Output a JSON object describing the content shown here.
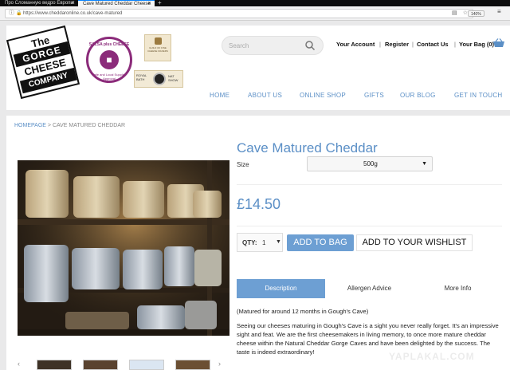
{
  "browser": {
    "tabs": [
      {
        "label": "Про Сломанную ведро Европы"
      },
      {
        "label": "Cave Matured Cheddar Cheese"
      }
    ],
    "url": "https://www.cheddaronline.co.uk/cave-matured",
    "zoom": "140%"
  },
  "header": {
    "logo": {
      "line1": "The Cheddar",
      "line2": "GORGE",
      "line3": "CHEESE",
      "line4": "COMPANY"
    },
    "salsa": {
      "top": "SALSA plus CHEESE",
      "bottom": "Safe and Local Supplier Approval"
    },
    "guild": "GUILD OF FINE CHEESE MAKERS",
    "show": {
      "left": "ROYAL BATH",
      "right": "NAT SHOW"
    },
    "search_placeholder": "Search",
    "links": {
      "account": "Your Account",
      "register": "Register",
      "contact": "Contact Us",
      "bag": "Your Bag (0)"
    },
    "nav": [
      "HOME",
      "ABOUT US",
      "ONLINE SHOP",
      "GIFTS",
      "OUR BLOG",
      "GET IN TOUCH"
    ]
  },
  "breadcrumb": {
    "home": "HOMEPAGE",
    "separator": ">",
    "current": "CAVE MATURED CHEDDAR"
  },
  "product": {
    "title": "Cave Matured Cheddar",
    "size_label": "Size",
    "size_value": "500g",
    "price": "£14.50",
    "qty_label": "QTY:",
    "qty_value": "1",
    "add_to_bag": "ADD TO BAG",
    "wishlist": "ADD TO YOUR WISHLIST",
    "tabs": [
      "Description",
      "Allergen Advice",
      "More Info"
    ],
    "active_tab": "Description",
    "description": [
      "(Matured for around 12 months in Gough's Cave)",
      "Seeing our cheeses maturing in Gough's Cave is a sight you never really forget. It's an impressive sight and feat. We are the first cheesemakers in living memory, to once more mature cheddar cheese within the Natural Cheddar Gorge Caves and have been delighted by the success. The taste is indeed extraordinary!"
    ]
  },
  "watermark": "YAPLAKAL.COM",
  "colors": {
    "accent": "#5b8fc6",
    "button": "#6d9fd3",
    "salsa": "#8b2b7a"
  }
}
